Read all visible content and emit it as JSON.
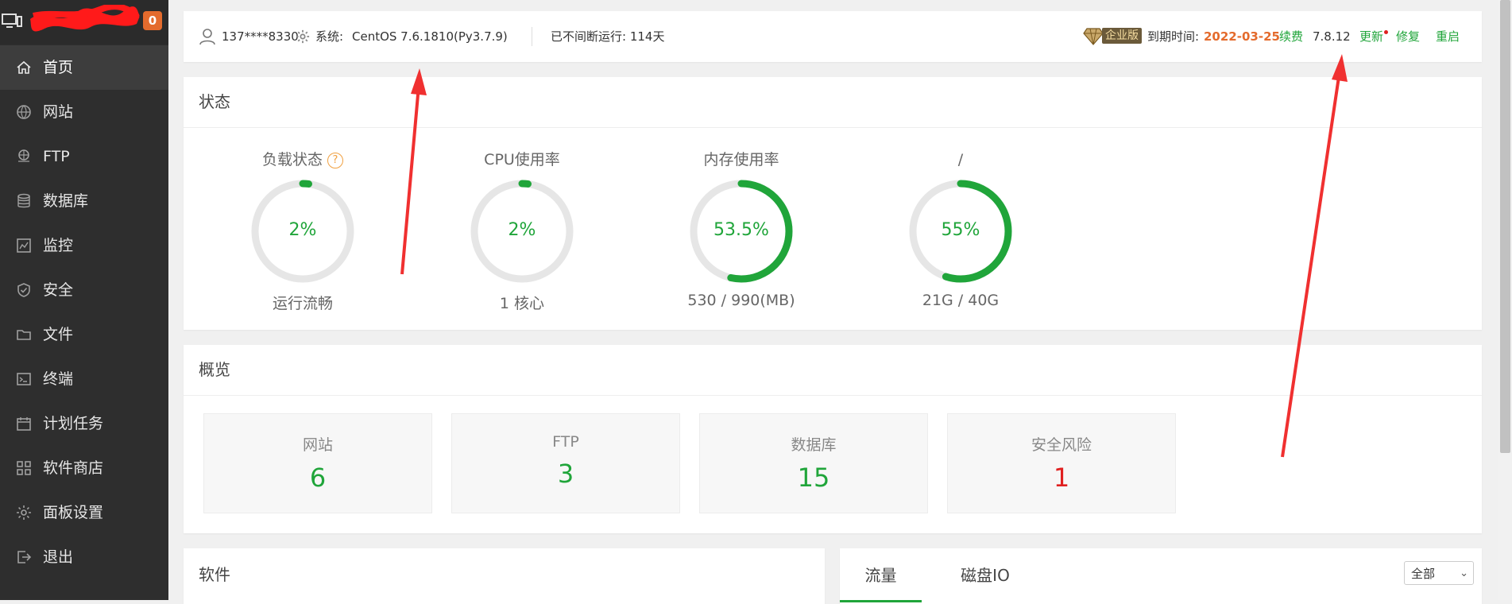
{
  "sidebar": {
    "badge": "0",
    "items": [
      {
        "label": "首页",
        "icon": "home-icon"
      },
      {
        "label": "网站",
        "icon": "globe-icon"
      },
      {
        "label": "FTP",
        "icon": "ftp-icon"
      },
      {
        "label": "数据库",
        "icon": "database-icon"
      },
      {
        "label": "监控",
        "icon": "monitor-chart-icon"
      },
      {
        "label": "安全",
        "icon": "shield-icon"
      },
      {
        "label": "文件",
        "icon": "folder-icon"
      },
      {
        "label": "终端",
        "icon": "terminal-icon"
      },
      {
        "label": "计划任务",
        "icon": "calendar-icon"
      },
      {
        "label": "软件商店",
        "icon": "grid-icon"
      },
      {
        "label": "面板设置",
        "icon": "gear-icon"
      },
      {
        "label": "退出",
        "icon": "logout-icon"
      }
    ]
  },
  "topbar": {
    "user": "137****8330",
    "system_label": "系统:",
    "system_value": "CentOS 7.6.1810(Py3.7.9)",
    "uptime": "已不间断运行: 114天",
    "edition": "企业版",
    "expire_label": "到期时间:",
    "expire_date": "2022-03-25",
    "renew": "续费",
    "version": "7.8.12",
    "update": "更新",
    "repair": "修复",
    "restart": "重启"
  },
  "status": {
    "title": "状态",
    "gauges": [
      {
        "title": "负载状态",
        "value": "2%",
        "percent": 2,
        "sub": "运行流畅"
      },
      {
        "title": "CPU使用率",
        "value": "2%",
        "percent": 2,
        "sub": "1 核心"
      },
      {
        "title": "内存使用率",
        "value": "53.5%",
        "percent": 53.5,
        "sub": "530 / 990(MB)"
      },
      {
        "title": "/",
        "value": "55%",
        "percent": 55,
        "sub": "21G / 40G"
      }
    ]
  },
  "overview": {
    "title": "概览",
    "items": [
      {
        "label": "网站",
        "value": "6"
      },
      {
        "label": "FTP",
        "value": "3"
      },
      {
        "label": "数据库",
        "value": "15"
      },
      {
        "label": "安全风险",
        "value": "1"
      }
    ]
  },
  "software": {
    "title": "软件"
  },
  "traffic": {
    "tabs": [
      "流量",
      "磁盘IO"
    ],
    "select_value": "全部"
  },
  "colors": {
    "accent": "#20a53a",
    "danger": "#e02020",
    "warning": "#e46b2d"
  }
}
